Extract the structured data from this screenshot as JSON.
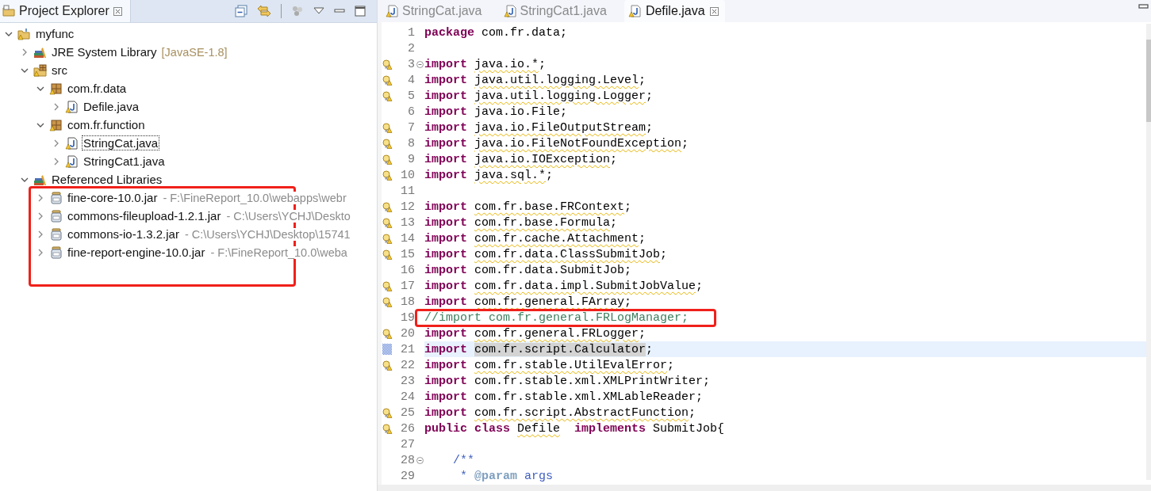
{
  "project_explorer": {
    "title": "Project Explorer",
    "tree": [
      {
        "label": "myfunc",
        "kind": "project",
        "warning": true,
        "expanded": true,
        "focused": false,
        "children": [
          {
            "label": "JRE System Library",
            "detail": "[JavaSE-1.8]",
            "kind": "library",
            "warning": false,
            "expanded": false,
            "focused": false
          },
          {
            "label": "src",
            "kind": "source-folder",
            "warning": true,
            "expanded": true,
            "focused": false,
            "children": [
              {
                "label": "com.fr.data",
                "kind": "package",
                "warning": true,
                "expanded": true,
                "focused": false,
                "children": [
                  {
                    "label": "Defile.java",
                    "kind": "java-file",
                    "warning": true,
                    "expanded": false,
                    "focused": false
                  }
                ]
              },
              {
                "label": "com.fr.function",
                "kind": "package",
                "warning": true,
                "expanded": true,
                "focused": false,
                "children": [
                  {
                    "label": "StringCat.java",
                    "kind": "java-file",
                    "warning": true,
                    "expanded": false,
                    "focused": true
                  },
                  {
                    "label": "StringCat1.java",
                    "kind": "java-file",
                    "warning": true,
                    "expanded": false,
                    "focused": false
                  }
                ]
              }
            ]
          },
          {
            "label": "Referenced Libraries",
            "kind": "library",
            "warning": false,
            "expanded": true,
            "focused": false,
            "annotated": true,
            "children": [
              {
                "label": "fine-core-10.0.jar",
                "detail": "- F:\\FineReport_10.0\\webapps\\webr",
                "kind": "jar",
                "warning": false,
                "expanded": false,
                "focused": false
              },
              {
                "label": "commons-fileupload-1.2.1.jar",
                "detail": "- C:\\Users\\YCHJ\\Deskto",
                "kind": "jar",
                "warning": false,
                "expanded": false,
                "focused": false
              },
              {
                "label": "commons-io-1.3.2.jar",
                "detail": "- C:\\Users\\YCHJ\\Desktop\\15741",
                "kind": "jar",
                "warning": false,
                "expanded": false,
                "focused": false
              },
              {
                "label": "fine-report-engine-10.0.jar",
                "detail": "- F:\\FineReport_10.0\\weba",
                "kind": "jar",
                "warning": false,
                "expanded": false,
                "focused": false
              }
            ]
          }
        ]
      }
    ]
  },
  "editor": {
    "tabs": [
      {
        "label": "StringCat.java",
        "selected": false
      },
      {
        "label": "StringCat1.java",
        "selected": false
      },
      {
        "label": "Defile.java",
        "selected": true
      }
    ],
    "lines": [
      {
        "number": "1",
        "warning": false,
        "occurrence": false,
        "foldable": false,
        "current": false,
        "segments": [
          {
            "kind": "keyword",
            "text": "package"
          },
          {
            "kind": "plain",
            "text": " com.fr.data;"
          }
        ]
      },
      {
        "number": "2",
        "warning": false,
        "occurrence": false,
        "foldable": false,
        "current": false
      },
      {
        "number": "3",
        "warning": true,
        "occurrence": false,
        "foldable": true,
        "current": false,
        "segments": [
          {
            "kind": "keyword",
            "text": "import"
          },
          {
            "kind": "warning",
            "text": " java.io.*"
          },
          {
            "kind": "plain",
            "text": ";"
          }
        ]
      },
      {
        "number": "4",
        "warning": true,
        "occurrence": false,
        "foldable": false,
        "current": false,
        "segments": [
          {
            "kind": "keyword",
            "text": "import"
          },
          {
            "kind": "warning",
            "text": " java.util.logging.Level"
          },
          {
            "kind": "plain",
            "text": ";"
          }
        ]
      },
      {
        "number": "5",
        "warning": true,
        "occurrence": false,
        "foldable": false,
        "current": false,
        "segments": [
          {
            "kind": "keyword",
            "text": "import"
          },
          {
            "kind": "warning",
            "text": " java.util.logging.Logger"
          },
          {
            "kind": "plain",
            "text": ";"
          }
        ]
      },
      {
        "number": "6",
        "warning": false,
        "occurrence": false,
        "foldable": false,
        "current": false,
        "segments": [
          {
            "kind": "keyword",
            "text": "import"
          },
          {
            "kind": "plain",
            "text": " java.io.File;"
          }
        ]
      },
      {
        "number": "7",
        "warning": true,
        "occurrence": false,
        "foldable": false,
        "current": false,
        "segments": [
          {
            "kind": "keyword",
            "text": "import"
          },
          {
            "kind": "warning",
            "text": " java.io.FileOutputStream"
          },
          {
            "kind": "plain",
            "text": ";"
          }
        ]
      },
      {
        "number": "8",
        "warning": true,
        "occurrence": false,
        "foldable": false,
        "current": false,
        "segments": [
          {
            "kind": "keyword",
            "text": "import"
          },
          {
            "kind": "warning",
            "text": " java.io.FileNotFoundException"
          },
          {
            "kind": "plain",
            "text": ";"
          }
        ]
      },
      {
        "number": "9",
        "warning": true,
        "occurrence": false,
        "foldable": false,
        "current": false,
        "segments": [
          {
            "kind": "keyword",
            "text": "import"
          },
          {
            "kind": "warning",
            "text": " java.io.IOException"
          },
          {
            "kind": "plain",
            "text": ";"
          }
        ]
      },
      {
        "number": "10",
        "warning": true,
        "occurrence": false,
        "foldable": false,
        "current": false,
        "segments": [
          {
            "kind": "keyword",
            "text": "import"
          },
          {
            "kind": "warning",
            "text": " java.sql.*"
          },
          {
            "kind": "plain",
            "text": ";"
          }
        ]
      },
      {
        "number": "11",
        "warning": false,
        "occurrence": false,
        "foldable": false,
        "current": false
      },
      {
        "number": "12",
        "warning": true,
        "occurrence": false,
        "foldable": false,
        "current": false,
        "segments": [
          {
            "kind": "keyword",
            "text": "import"
          },
          {
            "kind": "warning",
            "text": " com.fr.base.FRContext"
          },
          {
            "kind": "plain",
            "text": ";"
          }
        ]
      },
      {
        "number": "13",
        "warning": true,
        "occurrence": false,
        "foldable": false,
        "current": false,
        "segments": [
          {
            "kind": "keyword",
            "text": "import"
          },
          {
            "kind": "warning",
            "text": " com.fr.base.Formula"
          },
          {
            "kind": "plain",
            "text": ";"
          }
        ]
      },
      {
        "number": "14",
        "warning": true,
        "occurrence": false,
        "foldable": false,
        "current": false,
        "segments": [
          {
            "kind": "keyword",
            "text": "import"
          },
          {
            "kind": "warning",
            "text": " com.fr.cache.Attachment"
          },
          {
            "kind": "plain",
            "text": ";"
          }
        ]
      },
      {
        "number": "15",
        "warning": true,
        "occurrence": false,
        "foldable": false,
        "current": false,
        "segments": [
          {
            "kind": "keyword",
            "text": "import"
          },
          {
            "kind": "warning",
            "text": " com.fr.data.ClassSubmitJob"
          },
          {
            "kind": "plain",
            "text": ";"
          }
        ]
      },
      {
        "number": "16",
        "warning": false,
        "occurrence": false,
        "foldable": false,
        "current": false,
        "segments": [
          {
            "kind": "keyword",
            "text": "import"
          },
          {
            "kind": "plain",
            "text": " com.fr.data.SubmitJob;"
          }
        ]
      },
      {
        "number": "17",
        "warning": true,
        "occurrence": false,
        "foldable": false,
        "current": false,
        "segments": [
          {
            "kind": "keyword",
            "text": "import"
          },
          {
            "kind": "warning",
            "text": " com.fr.data.impl.SubmitJobValue"
          },
          {
            "kind": "plain",
            "text": ";"
          }
        ]
      },
      {
        "number": "18",
        "warning": true,
        "occurrence": false,
        "foldable": false,
        "current": false,
        "segments": [
          {
            "kind": "keyword",
            "text": "import"
          },
          {
            "kind": "warning",
            "text": " com.fr.general.FArray"
          },
          {
            "kind": "plain",
            "text": ";"
          }
        ]
      },
      {
        "number": "19",
        "warning": false,
        "occurrence": false,
        "foldable": false,
        "current": false,
        "annotated": true,
        "segments": [
          {
            "kind": "comment",
            "text": "//import com.fr.general.FRLogManager;"
          }
        ]
      },
      {
        "number": "20",
        "warning": true,
        "occurrence": false,
        "foldable": false,
        "current": false,
        "segments": [
          {
            "kind": "keyword",
            "text": "import"
          },
          {
            "kind": "warning",
            "text": " com.fr.general.FRLogger"
          },
          {
            "kind": "plain",
            "text": ";"
          }
        ]
      },
      {
        "number": "21",
        "warning": false,
        "occurrence": true,
        "foldable": false,
        "current": true,
        "segments": [
          {
            "kind": "keyword",
            "text": "import"
          },
          {
            "kind": "occurrence",
            "text": " com.fr.script.Calculator"
          },
          {
            "kind": "plain",
            "text": ";"
          }
        ]
      },
      {
        "number": "22",
        "warning": true,
        "occurrence": false,
        "foldable": false,
        "current": false,
        "segments": [
          {
            "kind": "keyword",
            "text": "import"
          },
          {
            "kind": "warning",
            "text": " com.fr.stable.UtilEvalError"
          },
          {
            "kind": "plain",
            "text": ";"
          }
        ]
      },
      {
        "number": "23",
        "warning": false,
        "occurrence": false,
        "foldable": false,
        "current": false,
        "segments": [
          {
            "kind": "keyword",
            "text": "import"
          },
          {
            "kind": "plain",
            "text": " com.fr.stable.xml.XMLPrintWriter;"
          }
        ]
      },
      {
        "number": "24",
        "warning": false,
        "occurrence": false,
        "foldable": false,
        "current": false,
        "segments": [
          {
            "kind": "keyword",
            "text": "import"
          },
          {
            "kind": "plain",
            "text": " com.fr.stable.xml.XMLableReader;"
          }
        ]
      },
      {
        "number": "25",
        "warning": true,
        "occurrence": false,
        "foldable": false,
        "current": false,
        "segments": [
          {
            "kind": "keyword",
            "text": "import"
          },
          {
            "kind": "warning",
            "text": " com.fr.script.AbstractFunction"
          },
          {
            "kind": "plain",
            "text": ";"
          }
        ]
      },
      {
        "number": "26",
        "warning": true,
        "occurrence": false,
        "foldable": false,
        "current": false,
        "segments": [
          {
            "kind": "keyword",
            "text": "public class"
          },
          {
            "kind": "warning",
            "text": " Defile"
          },
          {
            "kind": "keyword",
            "text": "  implements"
          },
          {
            "kind": "plain",
            "text": " SubmitJob{"
          }
        ]
      },
      {
        "number": "27",
        "warning": false,
        "occurrence": false,
        "foldable": false,
        "current": false
      },
      {
        "number": "28",
        "warning": false,
        "occurrence": false,
        "foldable": true,
        "current": false,
        "segments": [
          {
            "kind": "javadoc",
            "text": "    /**"
          }
        ]
      },
      {
        "number": "29",
        "warning": false,
        "occurrence": false,
        "foldable": false,
        "current": false,
        "segments": [
          {
            "kind": "javadoc",
            "text": "     *"
          },
          {
            "kind": "javadoc_tag",
            "text": " @param"
          },
          {
            "kind": "javadoc",
            "text": " args"
          }
        ]
      }
    ]
  }
}
